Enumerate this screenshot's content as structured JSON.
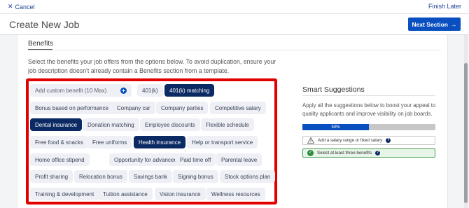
{
  "topbar": {
    "cancel_label": "Cancel",
    "finish_label": "Finish Later"
  },
  "header": {
    "title": "Create New Job",
    "next_label": "Next Section"
  },
  "benefits": {
    "title": "Benefits",
    "description": "Select the benefits your job offers from the options below. To avoid duplication, ensure your job description doesn't already contain a Benefits section from a template.",
    "custom_placeholder": "Add custom benefit (10 Max)",
    "options": [
      {
        "label": "401(k)",
        "selected": false
      },
      {
        "label": "401(k) matching",
        "selected": true
      },
      {
        "label": "Bonus based on performance",
        "selected": false
      },
      {
        "label": "Company car",
        "selected": false
      },
      {
        "label": "Company parties",
        "selected": false
      },
      {
        "label": "Competitive salary",
        "selected": false
      },
      {
        "label": "Dental insurance",
        "selected": true
      },
      {
        "label": "Donation matching",
        "selected": false
      },
      {
        "label": "Employee discounts",
        "selected": false
      },
      {
        "label": "Flexible schedule",
        "selected": false
      },
      {
        "label": "Free food & snacks",
        "selected": false
      },
      {
        "label": "Free uniforms",
        "selected": false
      },
      {
        "label": "Health insurance",
        "selected": true
      },
      {
        "label": "Help or transport service",
        "selected": false
      },
      {
        "label": "Home office stipend",
        "selected": false
      },
      {
        "label": "Opportunity for advancement",
        "selected": false
      },
      {
        "label": "Paid time off",
        "selected": false
      },
      {
        "label": "Parental leave",
        "selected": false
      },
      {
        "label": "Profit sharing",
        "selected": false
      },
      {
        "label": "Relocation bonus",
        "selected": false
      },
      {
        "label": "Savings bank",
        "selected": false
      },
      {
        "label": "Signing bonus",
        "selected": false
      },
      {
        "label": "Stock options plan",
        "selected": false
      },
      {
        "label": "Training & development",
        "selected": false
      },
      {
        "label": "Tuition assistance",
        "selected": false
      },
      {
        "label": "Vision insurance",
        "selected": false
      },
      {
        "label": "Wellness resources",
        "selected": false
      }
    ]
  },
  "smart_suggestions": {
    "title": "Smart Suggestions",
    "description": "Apply all the suggestions below to boost your appeal to quality applicants and improve visibility on job boards.",
    "progress_label": "50%",
    "progress_value": 0.5,
    "items": [
      {
        "label": "Add a salary range or fixed salary",
        "done": false,
        "icon": "warning-icon"
      },
      {
        "label": "Select at least three benefits",
        "done": true,
        "icon": "check-icon"
      }
    ]
  },
  "colors": {
    "accent": "#0a4fbf",
    "selected_chip": "#0b2a63",
    "highlight_box": "#e00000",
    "success": "#2e8b3d"
  }
}
